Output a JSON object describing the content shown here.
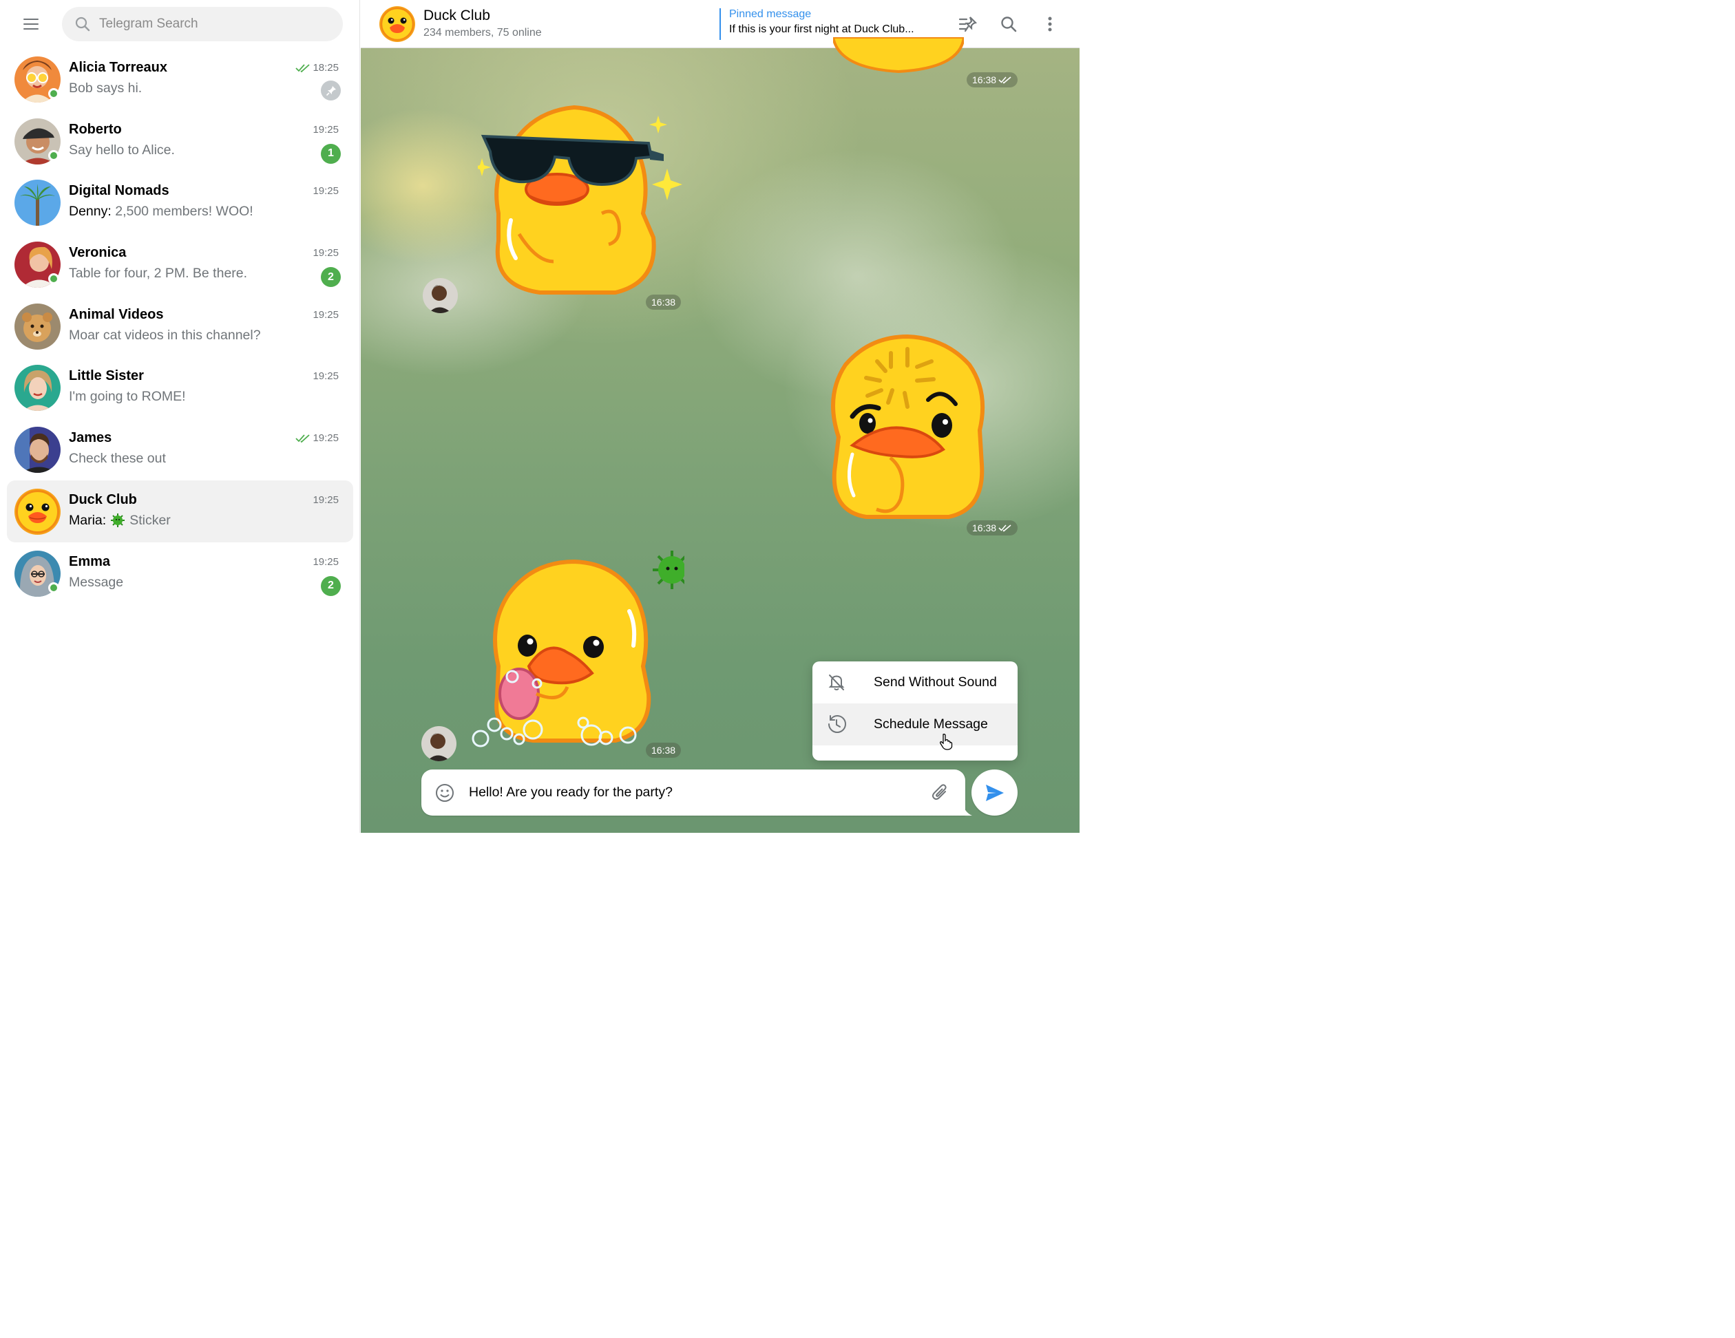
{
  "search": {
    "placeholder": "Telegram Search"
  },
  "chats": [
    {
      "name": "Alicia Torreaux",
      "sender": "",
      "preview": "Bob says hi.",
      "time": "18:25",
      "read": true,
      "badge": "",
      "pinned": true,
      "online": true
    },
    {
      "name": "Roberto",
      "sender": "",
      "preview": "Say hello to Alice.",
      "time": "19:25",
      "read": false,
      "badge": "1",
      "pinned": false,
      "online": true
    },
    {
      "name": "Digital Nomads",
      "sender": "Denny:",
      "preview": "2,500 members! WOO!",
      "time": "19:25",
      "read": false,
      "badge": "",
      "pinned": false,
      "online": false
    },
    {
      "name": "Veronica",
      "sender": "",
      "preview": "Table for four, 2 PM. Be there.",
      "time": "19:25",
      "read": false,
      "badge": "2",
      "pinned": false,
      "online": true
    },
    {
      "name": "Animal Videos",
      "sender": "",
      "preview": "Moar cat videos in this channel?",
      "time": "19:25",
      "read": false,
      "badge": "",
      "pinned": false,
      "online": false
    },
    {
      "name": "Little Sister",
      "sender": "",
      "preview": "I'm going to ROME!",
      "time": "19:25",
      "read": false,
      "badge": "",
      "pinned": false,
      "online": false
    },
    {
      "name": "James",
      "sender": "",
      "preview": "Check these out",
      "time": "19:25",
      "read": true,
      "badge": "",
      "pinned": false,
      "online": false
    },
    {
      "name": "Duck Club",
      "sender": "Maria:",
      "preview": "Sticker",
      "time": "19:25",
      "read": false,
      "badge": "",
      "pinned": false,
      "online": false
    },
    {
      "name": "Emma",
      "sender": "",
      "preview": "Message",
      "time": "19:25",
      "read": false,
      "badge": "2",
      "pinned": false,
      "online": true
    }
  ],
  "header": {
    "title": "Duck Club",
    "subtitle": "234 members, 75 online",
    "pinned_label": "Pinned message",
    "pinned_text": "If this is your first night at Duck Club..."
  },
  "messages": [
    {
      "time": "16:38",
      "outgoing": true,
      "sticker": "duck-partial"
    },
    {
      "time": "16:38",
      "outgoing": false,
      "sticker": "duck-sunglasses"
    },
    {
      "time": "16:38",
      "outgoing": true,
      "sticker": "duck-thinking"
    },
    {
      "time": "16:38",
      "outgoing": false,
      "sticker": "duck-soap"
    }
  ],
  "context_menu": {
    "send_without_sound": "Send Without Sound",
    "schedule_message": "Schedule Message"
  },
  "composer": {
    "value": "Hello! Are you ready for the party?"
  },
  "colors": {
    "accent": "#3390ec",
    "online": "#4fae4e",
    "badge": "#4fae4e",
    "check": "#4fae4e"
  }
}
